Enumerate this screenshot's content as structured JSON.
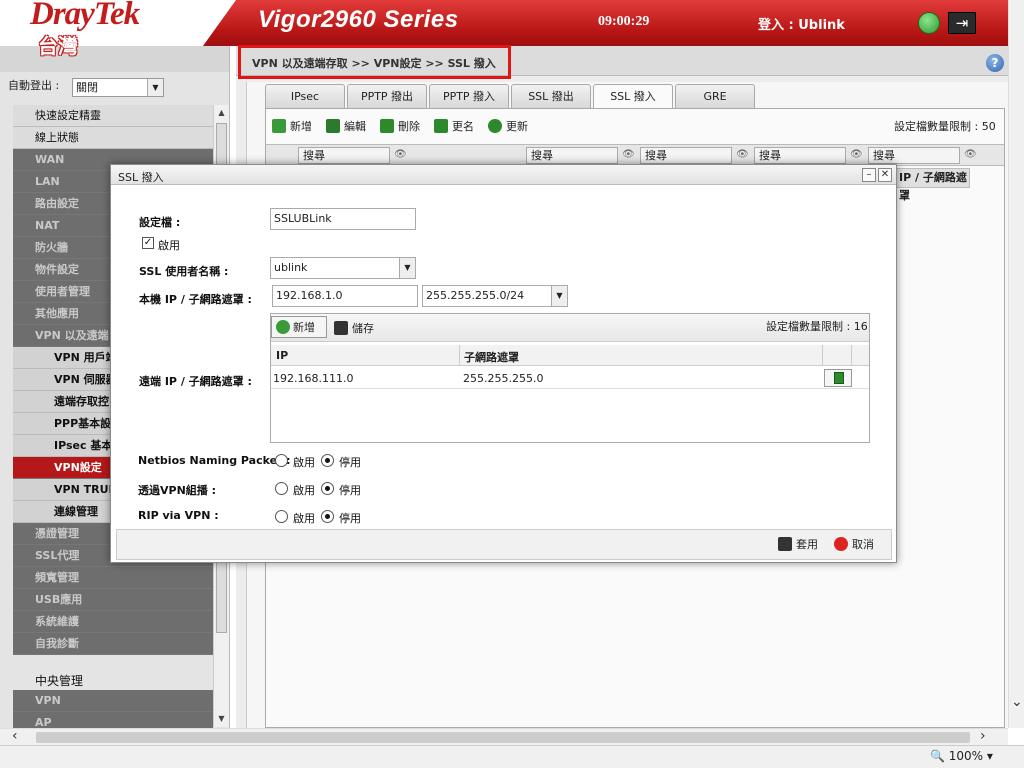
{
  "header": {
    "brand": "DrayTek",
    "region": "台灣",
    "model": "Vigor2960 Series",
    "time": "09:00:29",
    "login": "登入 : Ublink"
  },
  "sidebar": {
    "auto_logout_label": "自動登出 :",
    "auto_logout_value": "關閉",
    "items": [
      {
        "label": "快速設定精靈",
        "style": "light"
      },
      {
        "label": "線上狀態",
        "style": "light"
      },
      {
        "label": "WAN",
        "style": "dark"
      },
      {
        "label": "LAN",
        "style": "dark"
      },
      {
        "label": "路由設定",
        "style": "dark"
      },
      {
        "label": "NAT",
        "style": "dark"
      },
      {
        "label": "防火牆",
        "style": "dark"
      },
      {
        "label": "物件設定",
        "style": "dark"
      },
      {
        "label": "使用者管理",
        "style": "dark"
      },
      {
        "label": "其他應用",
        "style": "dark"
      },
      {
        "label": "VPN 以及遠端",
        "style": "dark"
      },
      {
        "label": "VPN 用戶端",
        "style": "sub"
      },
      {
        "label": "VPN 伺服器",
        "style": "sub"
      },
      {
        "label": "遠端存取控",
        "style": "sub"
      },
      {
        "label": "PPP基本設",
        "style": "sub"
      },
      {
        "label": "IPsec 基本",
        "style": "sub"
      },
      {
        "label": "VPN設定",
        "style": "active"
      },
      {
        "label": "VPN TRUN",
        "style": "sub"
      },
      {
        "label": "連線管理",
        "style": "sub"
      },
      {
        "label": "憑證管理",
        "style": "dark"
      },
      {
        "label": "SSL代理",
        "style": "dark"
      },
      {
        "label": "頻寬管理",
        "style": "dark"
      },
      {
        "label": "USB應用",
        "style": "dark"
      },
      {
        "label": "系統維護",
        "style": "dark"
      },
      {
        "label": "自我診斷",
        "style": "dark"
      }
    ],
    "central_title": "中央管理",
    "central_items": [
      {
        "label": "VPN",
        "style": "dark"
      },
      {
        "label": "AP",
        "style": "dark"
      }
    ]
  },
  "breadcrumb": "VPN 以及遠端存取 >> VPN設定 >> SSL 撥入",
  "tabs": [
    {
      "label": "IPsec",
      "width": 80
    },
    {
      "label": "PPTP 撥出",
      "width": 80
    },
    {
      "label": "PPTP 撥入",
      "width": 80
    },
    {
      "label": "SSL 撥出",
      "width": 80
    },
    {
      "label": "SSL 撥入",
      "width": 80,
      "active": true
    },
    {
      "label": "GRE",
      "width": 80
    }
  ],
  "toolbar": {
    "add": "新增",
    "edit": "編輯",
    "delete": "刪除",
    "rename": "更名",
    "refresh": "更新"
  },
  "profile_limit": "設定檔數量限制 : 50",
  "grid": {
    "search": "搜尋",
    "col_remote_ip": "IP / 子網路遮罩"
  },
  "dialog": {
    "title": "SSL 撥入",
    "profile_label": "設定檔 :",
    "profile_value": "SSLUBLink",
    "enable_label": "啟用",
    "ssl_user_label": "SSL 使用者名稱 :",
    "ssl_user_value": "ublink",
    "local_ip_label": "本機 IP / 子網路遮罩 :",
    "local_ip_value": "192.168.1.0",
    "local_mask_value": "255.255.255.0/24",
    "remote_label": "遠端 IP / 子網路遮罩 :",
    "remote_add": "新增",
    "remote_save": "儲存",
    "remote_limit": "設定檔數量限制 : 16",
    "remote_col_ip": "IP",
    "remote_col_mask": "子網路遮罩",
    "remote_row_ip": "192.168.111.0",
    "remote_row_mask": "255.255.255.0",
    "netbios_label": "Netbios Naming Packet :",
    "multicast_label": "透過VPN組播 :",
    "rip_label": "RIP via VPN :",
    "opt_enable": "啟用",
    "opt_disable": "停用",
    "apply": "套用",
    "cancel": "取消"
  },
  "zoom": "100%",
  "colors": {
    "brand_red": "#c41c1c",
    "active_nav": "#b41818",
    "highlight_border": "#e01515"
  }
}
